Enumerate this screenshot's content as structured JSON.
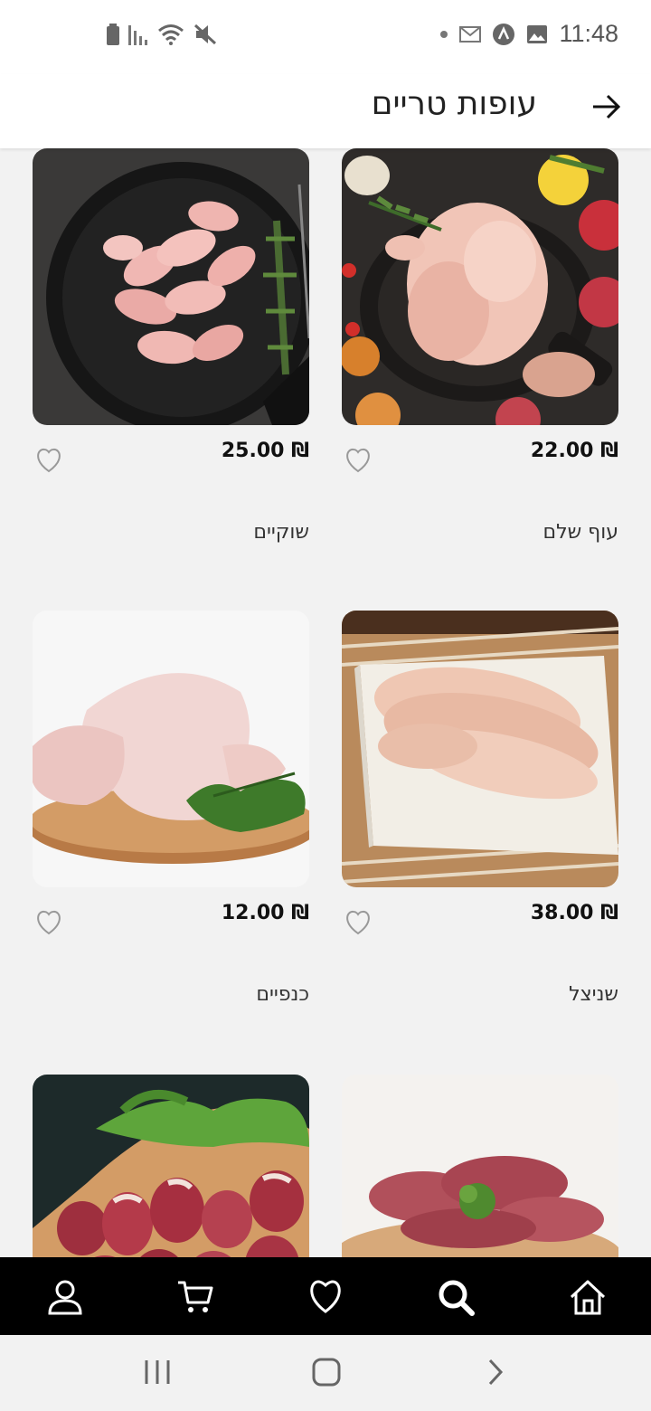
{
  "status_bar": {
    "time": "11:48",
    "left_icons": [
      "battery-icon",
      "signal-icon",
      "wifi-icon",
      "mute-icon"
    ],
    "right_icons": [
      "dot-icon",
      "gmail-icon",
      "app-icon",
      "gallery-icon"
    ]
  },
  "header": {
    "title": "עופות טריים",
    "back_icon": "arrow-right-icon"
  },
  "products": [
    {
      "name": "עוף שלם",
      "price": "₪ 22.00",
      "image": "whole-chicken-image"
    },
    {
      "name": "שוקיים",
      "price": "₪ 25.00",
      "image": "drumsticks-image"
    },
    {
      "name": "שניצל",
      "price": "₪ 38.00",
      "image": "schnitzel-image"
    },
    {
      "name": "כנפיים",
      "price": "₪ 12.00",
      "image": "wings-image"
    },
    {
      "name": "",
      "price": "",
      "image": "liver-image"
    },
    {
      "name": "",
      "price": "",
      "image": "hearts-image"
    }
  ],
  "bottom_nav": {
    "items": [
      "home-icon",
      "search-icon",
      "heart-icon",
      "cart-icon",
      "user-icon"
    ]
  },
  "system_nav": {
    "items": [
      "recent-apps-icon",
      "home-button-icon",
      "back-icon"
    ]
  },
  "colors": {
    "background": "#f2f2f2",
    "header": "#ffffff",
    "bottom_nav": "#000000",
    "price": "#111111"
  }
}
